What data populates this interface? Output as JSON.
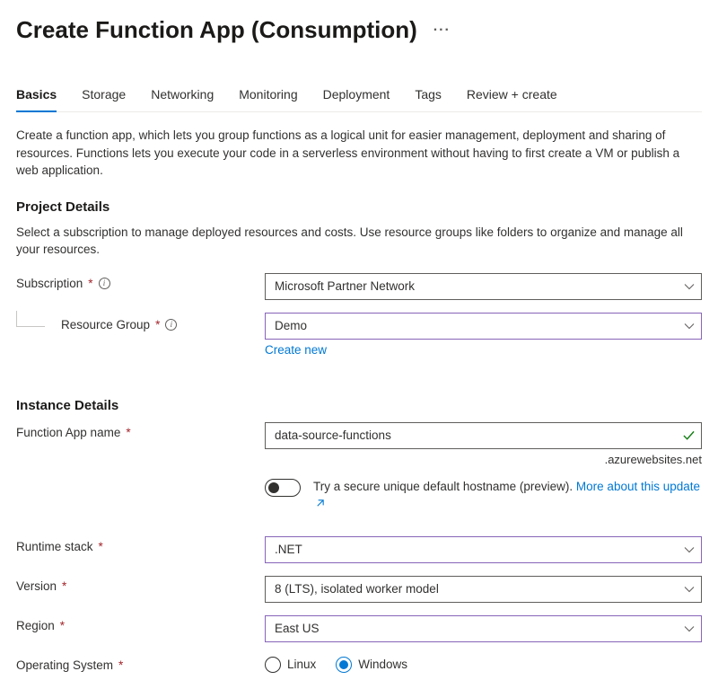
{
  "page": {
    "title": "Create Function App (Consumption)"
  },
  "tabs": [
    "Basics",
    "Storage",
    "Networking",
    "Monitoring",
    "Deployment",
    "Tags",
    "Review + create"
  ],
  "intro": "Create a function app, which lets you group functions as a logical unit for easier management, deployment and sharing of resources. Functions lets you execute your code in a serverless environment without having to first create a VM or publish a web application.",
  "sections": {
    "project": {
      "heading": "Project Details",
      "desc": "Select a subscription to manage deployed resources and costs. Use resource groups like folders to organize and manage all your resources.",
      "labels": {
        "subscription": "Subscription",
        "resourceGroup": "Resource Group",
        "createNew": "Create new"
      },
      "values": {
        "subscription": "Microsoft Partner Network",
        "resourceGroup": "Demo"
      }
    },
    "instance": {
      "heading": "Instance Details",
      "labels": {
        "appName": "Function App name",
        "runtime": "Runtime stack",
        "version": "Version",
        "region": "Region",
        "os": "Operating System"
      },
      "values": {
        "appName": "data-source-functions",
        "suffix": ".azurewebsites.net",
        "runtime": ".NET",
        "version": "8 (LTS), isolated worker model",
        "region": "East US"
      },
      "hostnameToggle": {
        "text": "Try a secure unique default hostname (preview).",
        "linkText": "More about this update"
      },
      "os": {
        "options": [
          "Linux",
          "Windows"
        ],
        "selected": "Windows"
      }
    }
  }
}
